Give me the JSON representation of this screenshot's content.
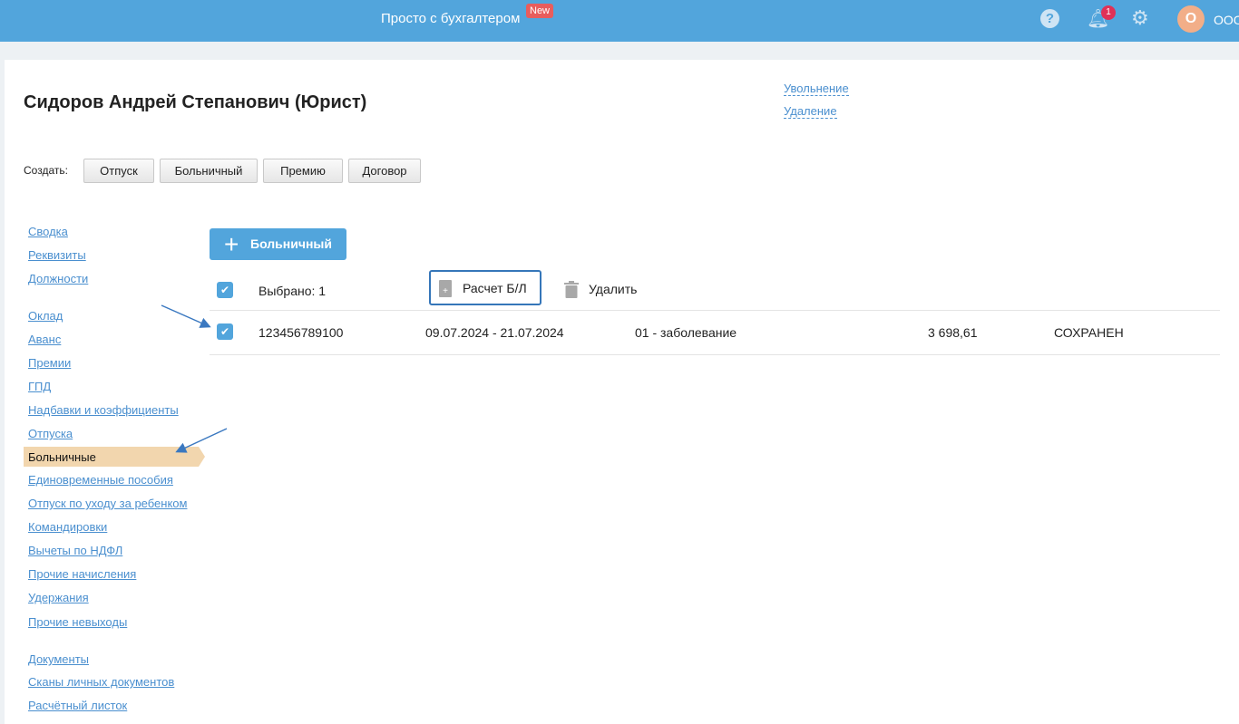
{
  "header": {
    "brand": "Просто с бухгалтером",
    "new_badge": "New",
    "notifications": "1",
    "avatar": "О",
    "org": "ООО"
  },
  "employee": {
    "title": "Сидоров Андрей Степанович (Юрист)",
    "links": [
      "Увольнение",
      "Удаление"
    ]
  },
  "create": {
    "label": "Создать:",
    "buttons": [
      "Отпуск",
      "Больничный",
      "Премию",
      "Договор"
    ]
  },
  "nav": {
    "group1": [
      "Сводка",
      "Реквизиты",
      "Должности"
    ],
    "group2": [
      "Оклад",
      "Аванс",
      "Премии",
      "ГПД",
      "Надбавки и коэффициенты",
      "Отпуска"
    ],
    "active": "Больничные",
    "group3": [
      "Единовременные пособия",
      "Отпуск по уходу за ребенком",
      "Командировки",
      "Вычеты по НДФЛ",
      "Прочие начисления",
      "Удержания",
      "Прочие невыходы"
    ],
    "group4": [
      "Документы",
      "Сканы личных документов",
      "Расчётный листок"
    ]
  },
  "main": {
    "add_label": "Больничный",
    "selected": "Выбрано: 1",
    "calc_label": "Расчет Б/Л",
    "delete_label": "Удалить",
    "rows": [
      {
        "number": "123456789100",
        "period": "09.07.2024 - 21.07.2024",
        "reason": "01 - заболевание",
        "amount": "3 698,61",
        "status": "СОХРАНЕН"
      }
    ]
  }
}
